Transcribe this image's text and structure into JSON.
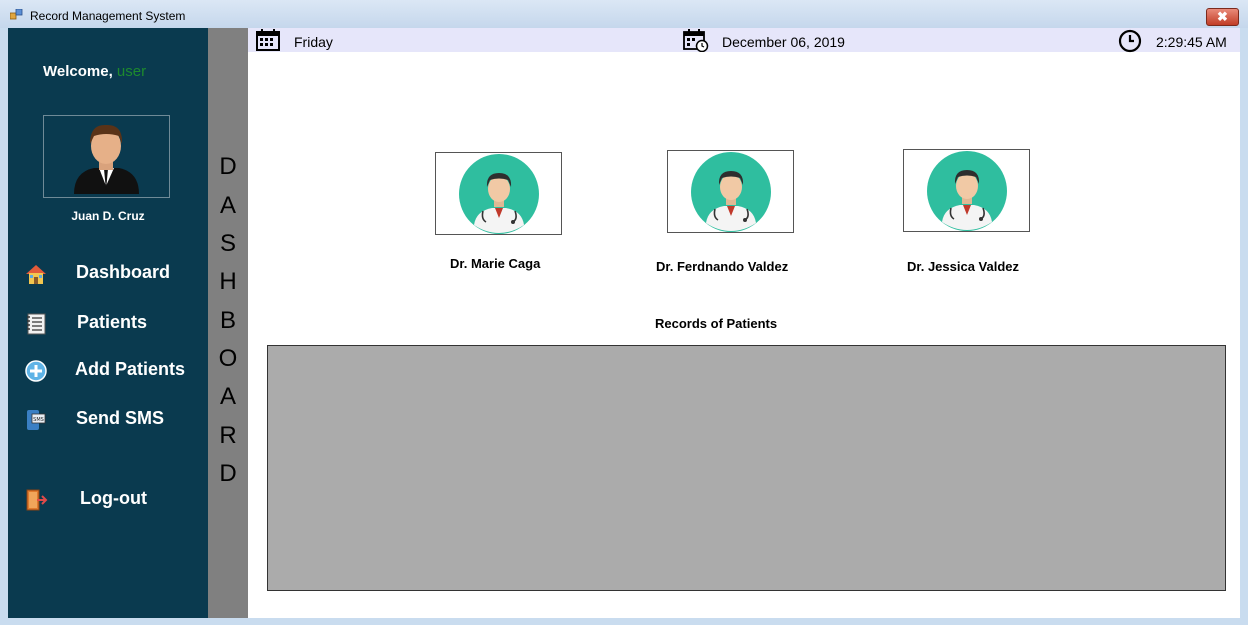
{
  "window": {
    "title": "Record Management System",
    "close_symbol": "✖"
  },
  "sidebar": {
    "welcome_label": "Welcome,",
    "welcome_user": "user",
    "user_name": "Juan D. Cruz",
    "items": [
      {
        "label": "Dashboard",
        "icon": "home-icon"
      },
      {
        "label": "Patients",
        "icon": "notebook-icon"
      },
      {
        "label": "Add Patients",
        "icon": "add-circle-icon"
      },
      {
        "label": "Send SMS",
        "icon": "sms-icon"
      },
      {
        "label": "Log-out",
        "icon": "logout-door-icon"
      }
    ]
  },
  "dashboard_letters": [
    "D",
    "A",
    "S",
    "H",
    "B",
    "O",
    "A",
    "R",
    "D"
  ],
  "info_bar": {
    "day": "Friday",
    "date": "December 06,  2019",
    "time": "2:29:45 AM"
  },
  "doctors": [
    {
      "name": "Dr. Marie Caga"
    },
    {
      "name": "Dr. Ferdnando Valdez"
    },
    {
      "name": "Dr. Jessica Valdez"
    }
  ],
  "records": {
    "title": "Records of Patients"
  },
  "colors": {
    "sidebar": "#0a3a4f",
    "accent_user": "#1d8a2e",
    "doctor_circle": "#2fbe9f",
    "grid": "#ababab",
    "info_bar": "#e6e6fa"
  }
}
